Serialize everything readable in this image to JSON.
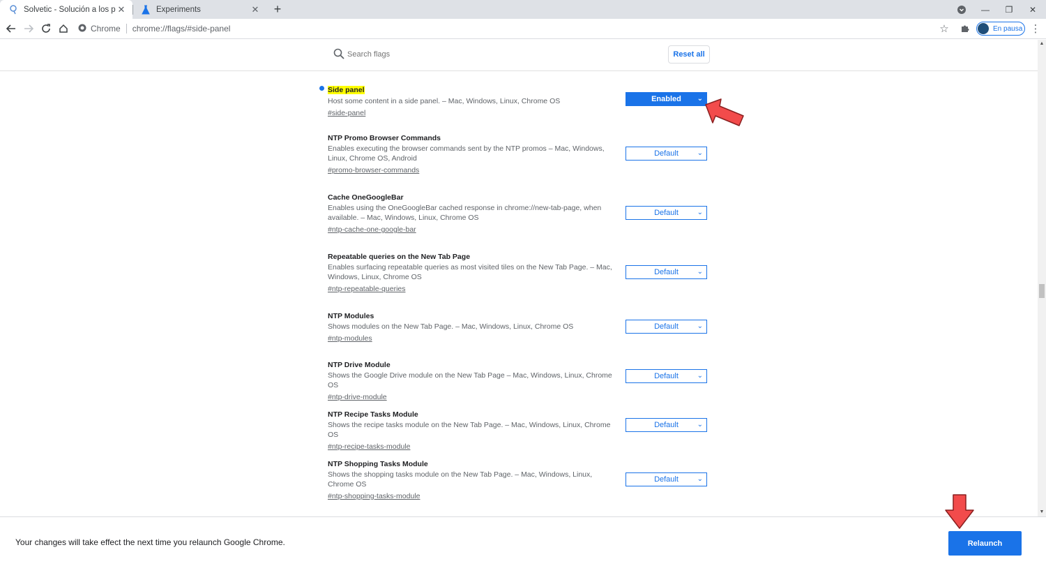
{
  "tabs": [
    {
      "title": "Solvetic - Solución a los problemas",
      "icon": "solvetic-favicon-icon"
    },
    {
      "title": "Experiments",
      "icon": "flask-icon"
    }
  ],
  "toolbar": {
    "site_chip": "Chrome",
    "url": "chrome://flags/#side-panel",
    "profile_label": "En pausa"
  },
  "search": {
    "placeholder": "Search flags",
    "reset_label": "Reset all"
  },
  "flags": [
    {
      "title": "Side panel",
      "desc": "Host some content in a side panel. – Mac, Windows, Linux, Chrome OS",
      "link": "#side-panel",
      "value": "Enabled",
      "highlighted": true
    },
    {
      "title": "NTP Promo Browser Commands",
      "desc": "Enables executing the browser commands sent by the NTP promos – Mac, Windows, Linux, Chrome OS, Android",
      "link": "#promo-browser-commands",
      "value": "Default"
    },
    {
      "title": "Cache OneGoogleBar",
      "desc": "Enables using the OneGoogleBar cached response in chrome://new-tab-page, when available. – Mac, Windows, Linux, Chrome OS",
      "link": "#ntp-cache-one-google-bar",
      "value": "Default"
    },
    {
      "title": "Repeatable queries on the New Tab Page",
      "desc": "Enables surfacing repeatable queries as most visited tiles on the New Tab Page. – Mac, Windows, Linux, Chrome OS",
      "link": "#ntp-repeatable-queries",
      "value": "Default"
    },
    {
      "title": "NTP Modules",
      "desc": "Shows modules on the New Tab Page. – Mac, Windows, Linux, Chrome OS",
      "link": "#ntp-modules",
      "value": "Default"
    },
    {
      "title": "NTP Drive Module",
      "desc": "Shows the Google Drive module on the New Tab Page – Mac, Windows, Linux, Chrome OS",
      "link": "#ntp-drive-module",
      "value": "Default"
    },
    {
      "title": "NTP Recipe Tasks Module",
      "desc": "Shows the recipe tasks module on the New Tab Page. – Mac, Windows, Linux, Chrome OS",
      "link": "#ntp-recipe-tasks-module",
      "value": "Default"
    },
    {
      "title": "NTP Shopping Tasks Module",
      "desc": "Shows the shopping tasks module on the New Tab Page. – Mac, Windows, Linux, Chrome OS",
      "link": "#ntp-shopping-tasks-module",
      "value": "Default"
    }
  ],
  "footer": {
    "message": "Your changes will take effect the next time you relaunch Google Chrome.",
    "relaunch_label": "Relaunch"
  },
  "colors": {
    "accent": "#1a73e8",
    "highlight": "#ffff00",
    "annotation_arrow": "#f24b4b"
  }
}
